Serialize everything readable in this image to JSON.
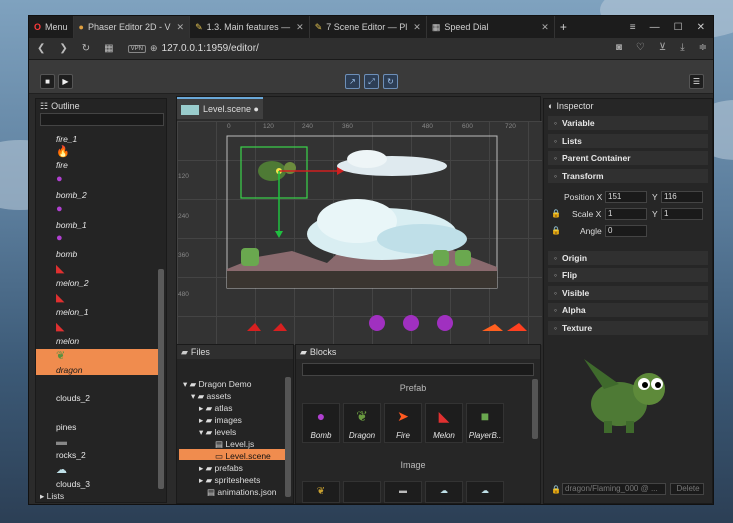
{
  "browser": {
    "menu_label": "Menu",
    "tabs": [
      {
        "label": "Phaser Editor 2D - V",
        "close": "✕"
      },
      {
        "label": "1.3. Main features —",
        "close": "✕"
      },
      {
        "label": "7  Scene Editor — Pl",
        "close": "✕"
      },
      {
        "label": "Speed Dial",
        "close": "✕"
      }
    ],
    "new_tab": "+",
    "url": "127.0.0.1:1959/editor/",
    "vpn": "VPN"
  },
  "outline": {
    "title": "Outline",
    "items": [
      "fire_1",
      "fire",
      "bomb_2",
      "bomb_1",
      "bomb",
      "melon_2",
      "melon_1",
      "melon",
      "dragon",
      "clouds_2",
      "pines",
      "rocks_2",
      "clouds_3"
    ],
    "lists_label": "Lists"
  },
  "scene": {
    "tab_label": "Level.scene",
    "ruler_x": [
      "0",
      "120",
      "240",
      "360",
      "480",
      "600",
      "720"
    ],
    "ruler_y": [
      "120",
      "240",
      "360",
      "480"
    ]
  },
  "files": {
    "title": "Files",
    "tree": [
      "Dragon Demo",
      "assets",
      "atlas",
      "images",
      "levels",
      "Level.js",
      "Level.scene",
      "prefabs",
      "spritesheets",
      "animations.json"
    ]
  },
  "blocks": {
    "title": "Blocks",
    "prefab_section": "Prefab",
    "image_section": "Image",
    "prefab_items": [
      "Bomb",
      "Dragon",
      "Fire",
      "Melon",
      "PlayerB.."
    ]
  },
  "inspector": {
    "title": "Inspector",
    "sections_top": [
      "Variable",
      "Lists",
      "Parent Container",
      "Transform"
    ],
    "position_label": "Position",
    "scale_label": "Scale",
    "angle_label": "Angle",
    "pos_x": "151",
    "pos_y": "116",
    "scale_x": "1",
    "scale_y": "1",
    "angle": "0",
    "x_label": "X",
    "y_label": "Y",
    "sections_bottom": [
      "Origin",
      "Flip",
      "Visible",
      "Alpha",
      "Texture"
    ],
    "texture_name": "dragon/Flaming_000 @ ...",
    "delete_label": "Delete"
  },
  "colors": {
    "selection": "#f08c4e",
    "accent": "#6aa8d8",
    "panel": "#262626"
  }
}
